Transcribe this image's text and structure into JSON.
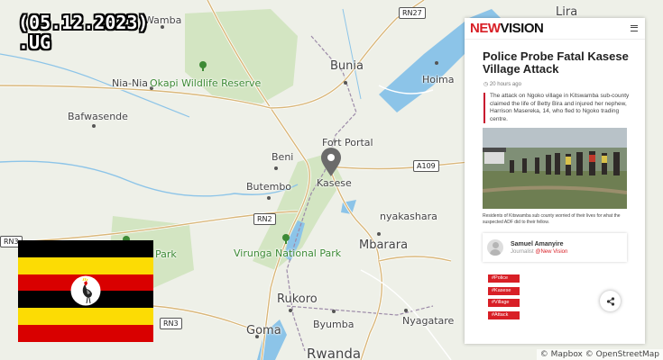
{
  "date_label": "(05.12.2023)",
  "country_code": ".UG",
  "map": {
    "places": {
      "wamba": "Wamba",
      "nia_nia": "Nia-Nia",
      "okapi": "Okapi Wildlife Reserve",
      "bafwasende": "Bafwasende",
      "bunia": "Bunia",
      "hoima": "Hoima",
      "lira": "Lira",
      "fort_portal": "Fort Portal",
      "beni": "Beni",
      "kasese": "Kasese",
      "butembo": "Butembo",
      "nyakashara": "nyakashara",
      "virunga": "Virunga National Park",
      "park": "Park",
      "mbarara": "Mbarara",
      "rukoro": "Rukoro",
      "byumba": "Byumba",
      "nyagatare": "Nyagatare",
      "goma": "Goma",
      "rwanda": "Rwanda"
    },
    "roads": {
      "rn27": "RN27",
      "a109": "A109",
      "rn2": "RN2",
      "rn3_left": "RN3",
      "rn3": "RN3"
    },
    "attribution": "© Mapbox © OpenStreetMap",
    "colors": {
      "water": "#8cc4e8",
      "land": "#eef0e8",
      "forest": "#d3e5c2",
      "park_label": "#3d8a35"
    }
  },
  "flag": {
    "country": "Uganda",
    "stripe_colors": [
      "#000000",
      "#fcdc04",
      "#d90000",
      "#000000",
      "#fcdc04",
      "#d90000"
    ],
    "emblem": "crested-crane"
  },
  "article": {
    "logo_prefix": "NEW",
    "logo_suffix": "VISION",
    "headline": "Police Probe Fatal Kasese Village Attack",
    "time_ago": "20 hours ago",
    "lead": "The attack on Ngoko village in Kitswamba sub-county claimed the life of Betty Bira and injured her nephew, Harrison Masereka, 14, who fled to Ngoko trading centre.",
    "caption": "Residents of Kitswamba sub county worried of their lives for what the suspected ADF did to their fellow.",
    "author_name": "Samuel Amanyire",
    "author_role": "Journalist",
    "author_source": "@New Vision",
    "tags": [
      "#Police",
      "#Kasese",
      "#Village",
      "#Attack"
    ],
    "accent_color": "#d81f26"
  }
}
